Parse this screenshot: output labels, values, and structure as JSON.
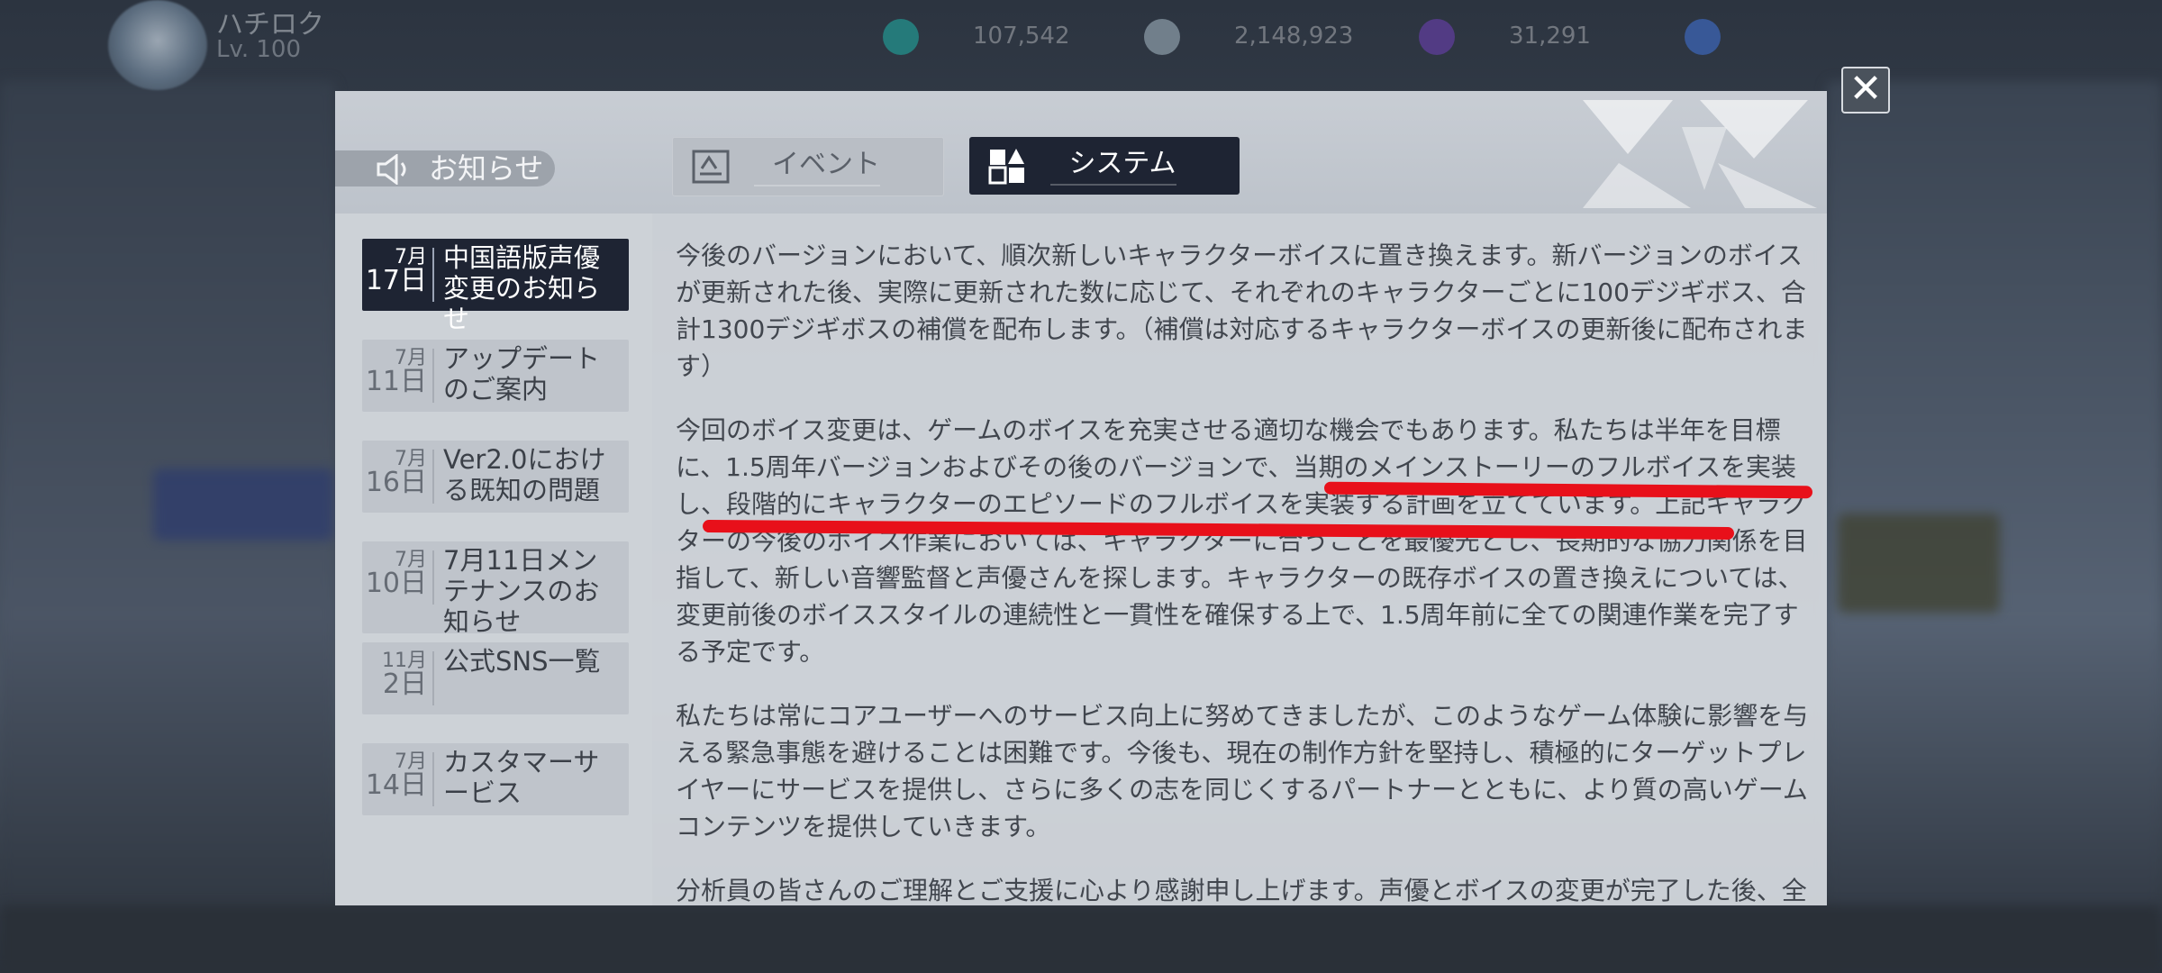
{
  "player": {
    "name": "ハチロク",
    "level_text": "Lv. 100"
  },
  "resources": [
    {
      "value": "107,542",
      "color": "#1fa9a0"
    },
    {
      "value": "2,148,923",
      "color": "#9fb0bd"
    },
    {
      "value": "31,291",
      "color": "#6b3fb0"
    },
    {
      "value": "",
      "color": "#3f6fd1"
    }
  ],
  "header": {
    "notice_label": "お知らせ",
    "tabs": [
      {
        "label": "イベント",
        "active": false
      },
      {
        "label": "システム",
        "active": true
      }
    ]
  },
  "sidebar": {
    "items": [
      {
        "month": "7月",
        "day": "17日",
        "title": "中国語版声優変更のお知らせ",
        "active": true
      },
      {
        "month": "7月",
        "day": "11日",
        "title": "アップデートのご案内",
        "active": false
      },
      {
        "month": "7月",
        "day": "16日",
        "title": "Ver2.0における既知の問題",
        "active": false
      },
      {
        "month": "7月",
        "day": "10日",
        "title": "7月11日メンテナンスのお知らせ",
        "active": false
      },
      {
        "month": "11月",
        "day": "2日",
        "title": "公式SNS一覧",
        "active": false
      },
      {
        "month": "7月",
        "day": "14日",
        "title": "カスタマーサービス",
        "active": false
      }
    ]
  },
  "content": {
    "paragraphs": [
      "今後のバージョンにおいて、順次新しいキャラクターボイスに置き換えます。新バージョンのボイスが更新された後、実際に更新された数に応じて、それぞれのキャラクターごとに100デジギボス、合計1300デジギボスの補償を配布します。（補償は対応するキャラクターボイスの更新後に配布されます）",
      "今回のボイス変更は、ゲームのボイスを充実させる適切な機会でもあります。私たちは半年を目標に、1.5周年バージョンおよびその後のバージョンで、当期のメインストーリーのフルボイスを実装し、段階的にキャラクターのエピソードのフルボイスを実装する計画を立てています。上記キャラクターの今後のボイス作業においては、キャラクターに合うことを最優先とし、長期的な協力関係を目指して、新しい音響監督と声優さんを探します。キャラクターの既存ボイスの置き換えについては、変更前後のボイススタイルの連続性と一貫性を確保する上で、1.5周年前に全ての関連作業を完了する予定です。",
      "私たちは常にコアユーザーへのサービス向上に努めてきましたが、このようなゲーム体験に影響を与える緊急事態を避けることは困難です。今後も、現在の制作方針を堅持し、積極的にターゲットプレイヤーにサービスを提供し、さらに多くの志を同じくするパートナーとともに、より質の高いゲームコンテンツを提供していきます。",
      "分析員の皆さんのご理解とご支援に心より感謝申し上げます。声優とボイスの変更が完了した後、全"
    ]
  },
  "colors": {
    "active_dark": "#1e2433",
    "highlight_red": "#e8101a"
  }
}
